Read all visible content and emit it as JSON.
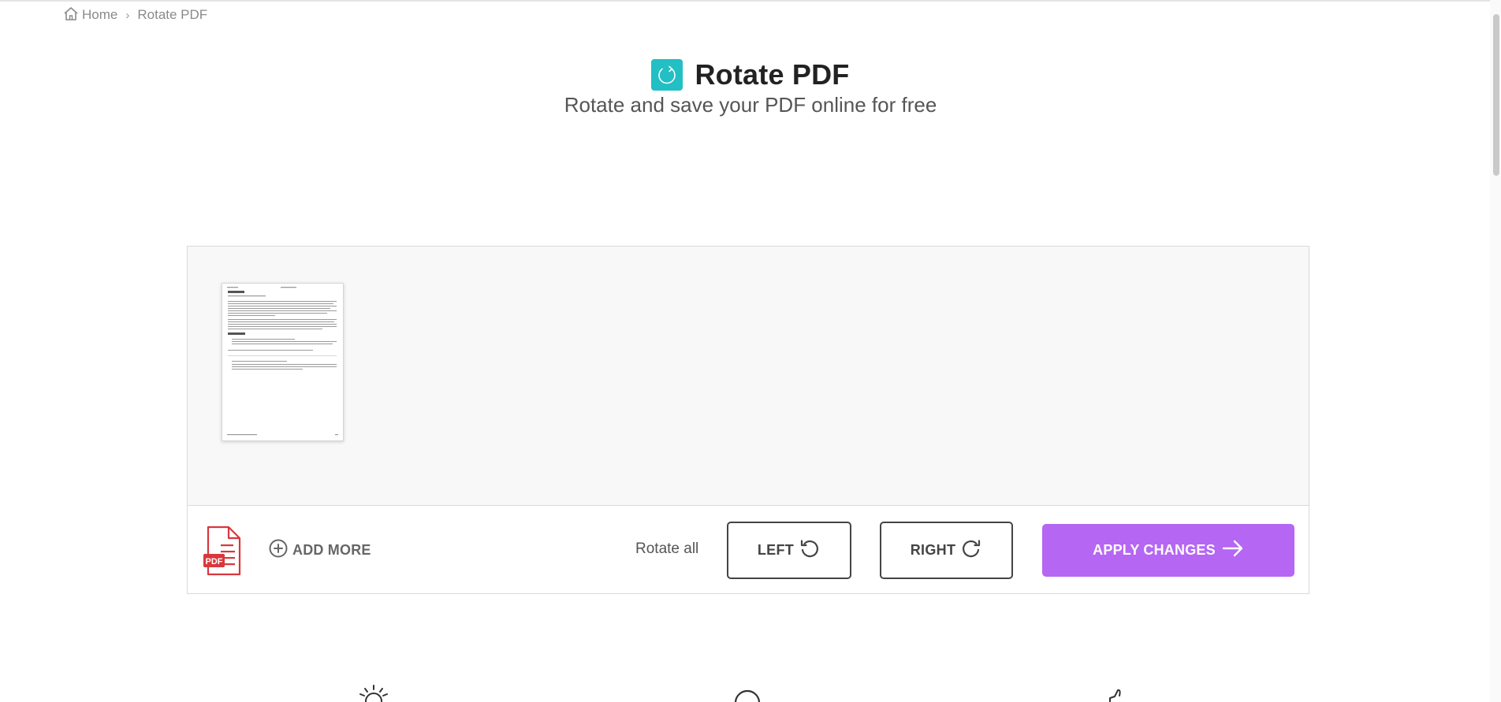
{
  "breadcrumb": {
    "home_label": "Home",
    "separator": "›",
    "current_label": "Rotate PDF"
  },
  "header": {
    "title": "Rotate PDF",
    "subtitle": "Rotate and save your PDF online for free",
    "logo_icon": "rotate-icon",
    "logo_color": "#22bfc4"
  },
  "workspace": {
    "thumbnail_alt": "PDF page 1",
    "file_type_badge": "PDF",
    "add_more_label": "ADD MORE",
    "rotate_all_label": "Rotate all",
    "left_button_label": "LEFT",
    "right_button_label": "RIGHT",
    "apply_button_label": "APPLY CHANGES",
    "apply_color": "#b566f2",
    "file_icon_color": "#d8373d"
  }
}
